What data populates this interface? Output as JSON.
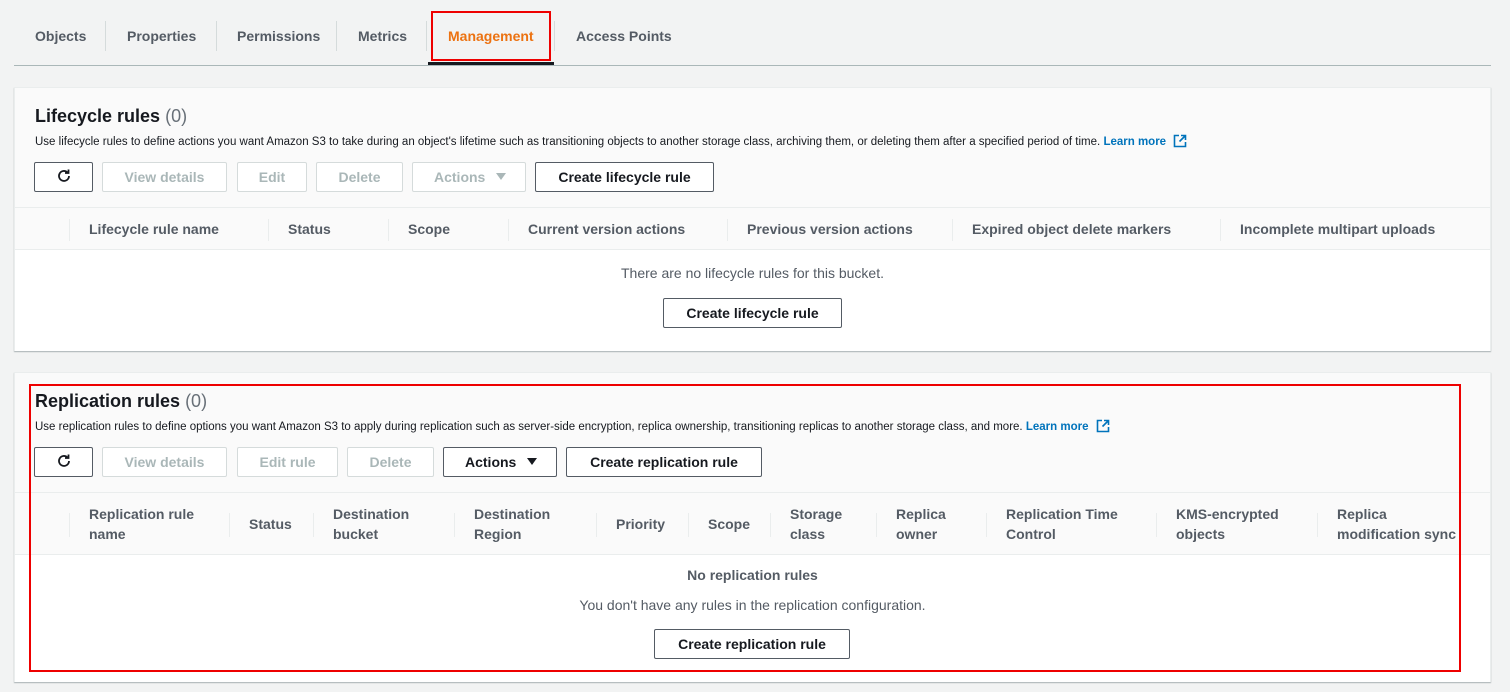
{
  "tabs": [
    {
      "label": "Objects"
    },
    {
      "label": "Properties"
    },
    {
      "label": "Permissions"
    },
    {
      "label": "Metrics"
    },
    {
      "label": "Management"
    },
    {
      "label": "Access Points"
    }
  ],
  "lifecycle": {
    "title": "Lifecycle rules",
    "count": "(0)",
    "description": "Use lifecycle rules to define actions you want Amazon S3 to take during an object's lifetime such as transitioning objects to another storage class, archiving them, or deleting them after a specified period of time.",
    "learn_more": "Learn more",
    "buttons": {
      "view_details": "View details",
      "edit": "Edit",
      "delete": "Delete",
      "actions": "Actions",
      "create": "Create lifecycle rule"
    },
    "columns": [
      "Lifecycle rule name",
      "Status",
      "Scope",
      "Current version actions",
      "Previous version actions",
      "Expired object delete markers",
      "Incomplete multipart uploads"
    ],
    "empty_text": "There are no lifecycle rules for this bucket.",
    "empty_button": "Create lifecycle rule"
  },
  "replication": {
    "title": "Replication rules",
    "count": "(0)",
    "description": "Use replication rules to define options you want Amazon S3 to apply during replication such as server-side encryption, replica ownership, transitioning replicas to another storage class, and more.",
    "learn_more": "Learn more",
    "buttons": {
      "view_details": "View details",
      "edit": "Edit rule",
      "delete": "Delete",
      "actions": "Actions",
      "create": "Create replication rule"
    },
    "columns": [
      [
        "Replication rule",
        "name"
      ],
      [
        "Status",
        ""
      ],
      [
        "Destination",
        "bucket"
      ],
      [
        "Destination",
        "Region"
      ],
      [
        "Priority",
        ""
      ],
      [
        "Scope",
        ""
      ],
      [
        "Storage",
        "class"
      ],
      [
        "Replica",
        "owner"
      ],
      [
        "Replication Time",
        "Control"
      ],
      [
        "KMS-encrypted",
        "objects"
      ],
      [
        "Replica",
        "modification sync"
      ]
    ],
    "empty_title": "No replication rules",
    "empty_text": "You don't have any rules in the replication configuration.",
    "empty_button": "Create replication rule"
  },
  "colors": {
    "accent": "#ec7211",
    "link": "#0073bb",
    "highlight": "#e00000"
  }
}
